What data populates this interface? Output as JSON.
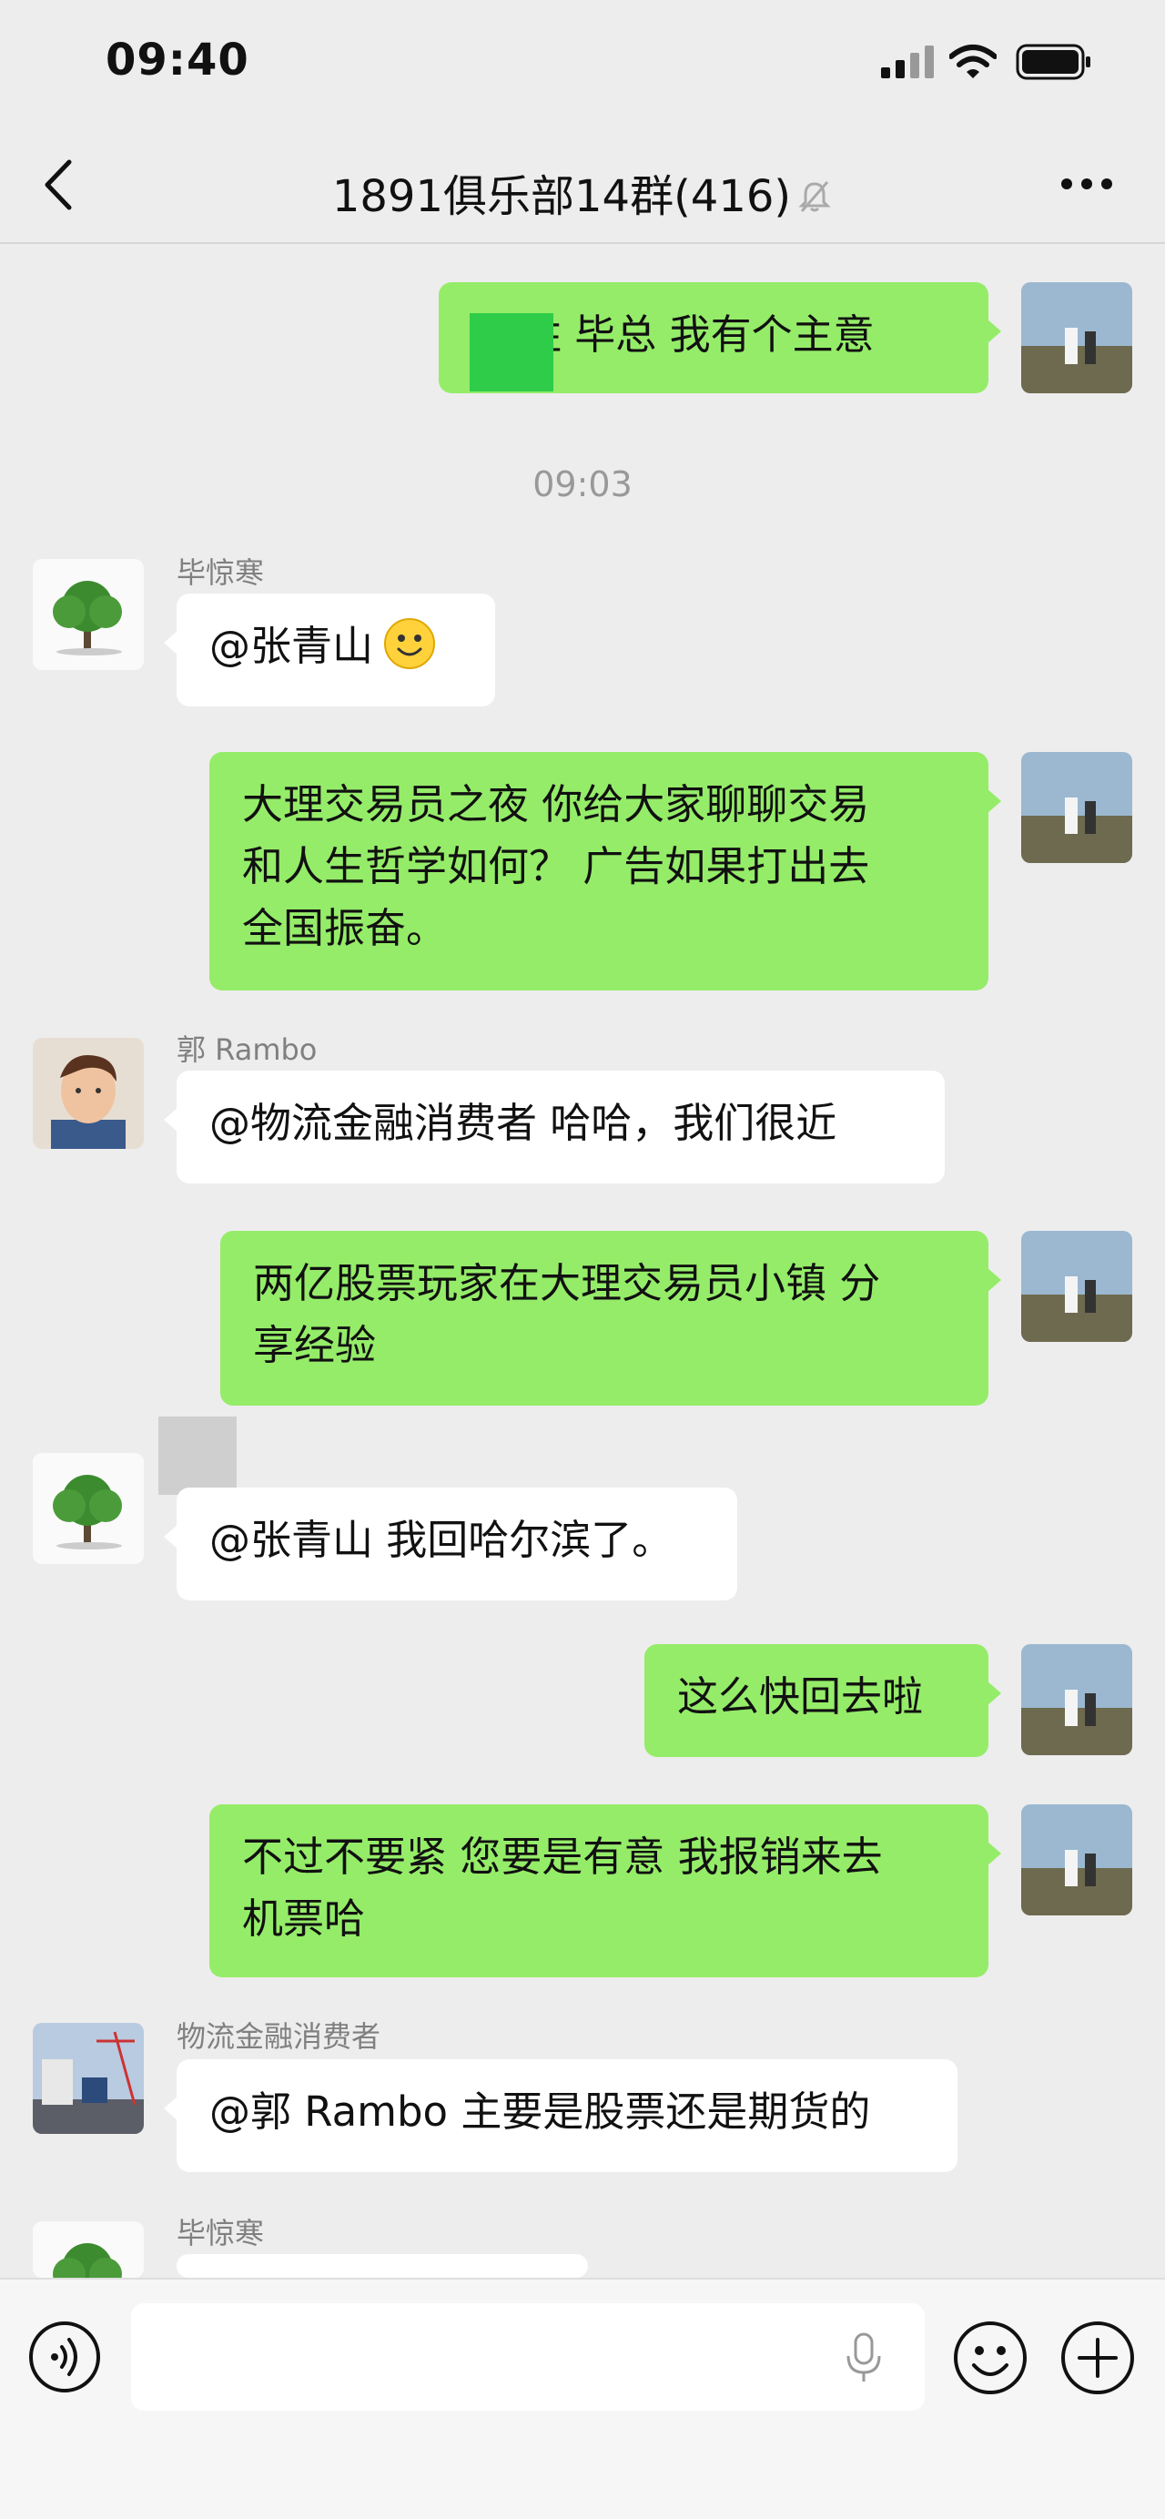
{
  "status_bar": {
    "time": "09:40"
  },
  "header": {
    "title": "1891俱乐部14群(416)"
  },
  "timestamp": "09:03",
  "messages": [
    {
      "text": "胜 毕总 我有个主意"
    },
    {
      "sender": "毕惊寒",
      "text": "@张青山"
    },
    {
      "text": "大理交易员之夜 你给大家聊聊交易\n和人生哲学如何？ 广告如果打出去\n全国振奋。"
    },
    {
      "sender": "郭 Rambo",
      "text": "@物流金融消费者 哈哈，我们很近"
    },
    {
      "text": "两亿股票玩家在大理交易员小镇 分\n享经验"
    },
    {
      "text": "@张青山 我回哈尔滨了。"
    },
    {
      "text": "这么快回去啦"
    },
    {
      "text": "不过不要紧 您要是有意 我报销来去\n机票哈"
    },
    {
      "sender": "物流金融消费者",
      "text": "@郭 Rambo 主要是股票还是期货的"
    },
    {
      "sender": "毕惊寒",
      "text": ""
    }
  ],
  "colors": {
    "outgoing_bubble": "#95ec69",
    "incoming_bubble": "#ffffff",
    "background": "#ededed"
  },
  "icons": [
    "signal-icon",
    "wifi-icon",
    "battery-icon",
    "back-icon",
    "mute-icon",
    "more-icon",
    "voice-icon",
    "mic-icon",
    "emoji-icon",
    "plus-icon"
  ]
}
